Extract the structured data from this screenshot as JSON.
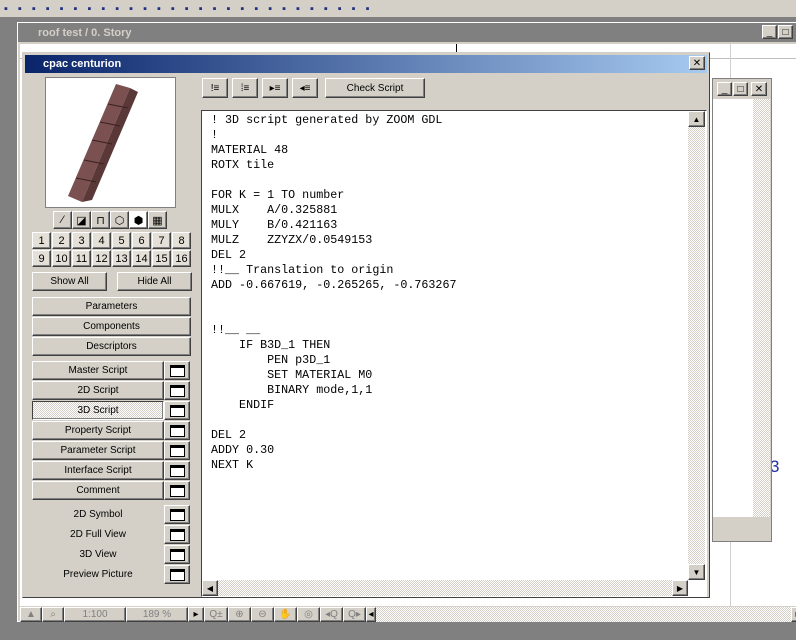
{
  "main_toolbar": {
    "icons": [
      "undo-icon",
      "redo-icon",
      "cut-icon",
      "copy-icon",
      "paste-icon",
      "dimension-icon",
      "find-icon",
      "group-icon",
      "align-icon",
      "elevation-icon",
      "drag-icon",
      "hatch-icon",
      "align-left-icon",
      "align-center-icon",
      "mirror-icon",
      "rotate-icon",
      "trace-icon",
      "layer-icon",
      "layer2-icon",
      "view-3d-icon",
      "camera-icon",
      "home-icon",
      "marker-icon",
      "zoom-in-icon",
      "zoom-out-icon",
      "window-icon",
      "window2-icon"
    ]
  },
  "story_window": {
    "title": "roof test / 0. Story",
    "canvas_label": "3",
    "scale": "1:100",
    "zoom": "189 %"
  },
  "dialog": {
    "title": "cpac centurion",
    "view_buttons": [
      "floor-plan-icon",
      "side-view-icon",
      "elevation-view-icon",
      "wireframe-icon",
      "shaded-icon",
      "film-icon"
    ],
    "numbers": [
      "1",
      "2",
      "3",
      "4",
      "5",
      "6",
      "7",
      "8",
      "9",
      "10",
      "11",
      "12",
      "13",
      "14",
      "15",
      "16"
    ],
    "show_all": "Show All",
    "hide_all": "Hide All",
    "sections": [
      "Parameters",
      "Components",
      "Descriptors"
    ],
    "scripts": [
      {
        "label": "Master Script",
        "selected": false
      },
      {
        "label": "2D Script",
        "selected": false
      },
      {
        "label": "3D Script",
        "selected": true
      },
      {
        "label": "Property Script",
        "selected": false
      },
      {
        "label": "Parameter Script",
        "selected": false
      },
      {
        "label": "Interface Script",
        "selected": false
      },
      {
        "label": "Comment",
        "selected": false
      }
    ],
    "views": [
      "2D Symbol",
      "2D Full View",
      "3D View",
      "Preview Picture"
    ],
    "check_script": "Check Script",
    "code": {
      "lines": [
        "! 3D script generated by ZOOM GDL",
        "!",
        "MATERIAL 48",
        "ROTX tile",
        "",
        "FOR K = 1 TO number",
        "MULX    A/0.325881",
        "MULY    B/0.421163",
        "MULZ    ZZYZX/0.0549153",
        "DEL 2",
        "!!__ Translation to origin",
        "ADD -0.667619, -0.265265, -0.763267",
        "",
        "",
        "!!__ __",
        "    IF B3D_1 THEN",
        "        PEN p3D_1",
        "        SET MATERIAL M0",
        "        BINARY mode,1,1",
        "    ENDIF",
        "",
        "DEL 2",
        "ADDY 0.30",
        "NEXT K"
      ]
    }
  }
}
